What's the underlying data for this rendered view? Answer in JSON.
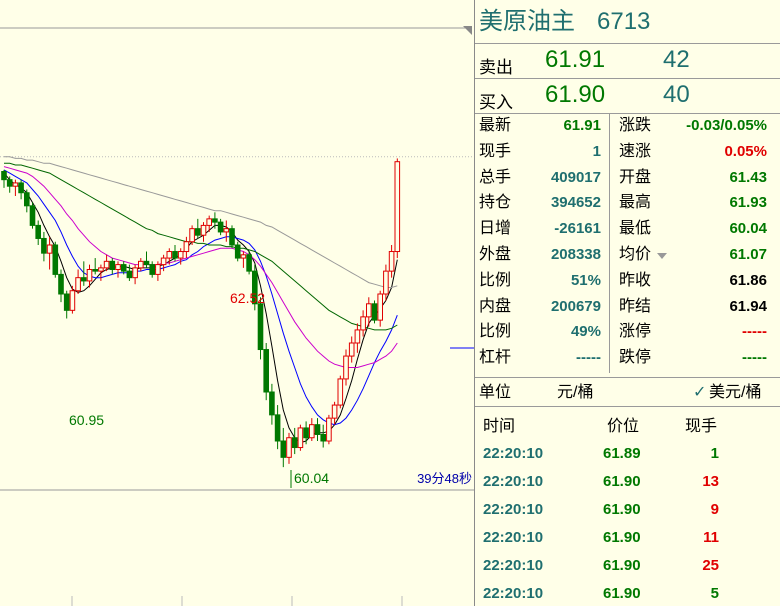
{
  "header": {
    "name": "美原油主",
    "code": "6713"
  },
  "order_book": [
    {
      "label": "卖出",
      "price": "61.91",
      "volume": "42"
    },
    {
      "label": "买入",
      "price": "61.90",
      "volume": "40"
    }
  ],
  "stats_left": [
    {
      "label": "最新",
      "value": "61.91",
      "color": "#007800"
    },
    {
      "label": "现手",
      "value": "1",
      "color": "#1f6f6f"
    },
    {
      "label": "总手",
      "value": "409017",
      "color": "#1f6f6f"
    },
    {
      "label": "持仓",
      "value": "394652",
      "color": "#1f6f6f"
    },
    {
      "label": "日增",
      "value": "-26161",
      "color": "#1f6f6f"
    },
    {
      "label": "外盘",
      "value": "208338",
      "color": "#1f6f6f"
    },
    {
      "label": "比例",
      "value": "51%",
      "color": "#1f6f6f"
    },
    {
      "label": "内盘",
      "value": "200679",
      "color": "#1f6f6f"
    },
    {
      "label": "比例",
      "value": "49%",
      "color": "#1f6f6f"
    },
    {
      "label": "杠杆",
      "value": "-----",
      "color": "#1f6f6f"
    }
  ],
  "stats_right": [
    {
      "label": "涨跌",
      "value": "-0.03/0.05%",
      "color": "#007800"
    },
    {
      "label": "速涨",
      "value": "0.05%",
      "color": "#e00000"
    },
    {
      "label": "开盘",
      "value": "61.43",
      "color": "#007800"
    },
    {
      "label": "最高",
      "value": "61.93",
      "color": "#007800"
    },
    {
      "label": "最低",
      "value": "60.04",
      "color": "#007800"
    },
    {
      "label": "均价",
      "value": "61.07",
      "color": "#007800"
    },
    {
      "label": "昨收",
      "value": "61.86",
      "color": "#000000"
    },
    {
      "label": "昨结",
      "value": "61.94",
      "color": "#000000"
    },
    {
      "label": "涨停",
      "value": "-----",
      "color": "#e00000"
    },
    {
      "label": "跌停",
      "value": "-----",
      "color": "#007800"
    }
  ],
  "unit": {
    "label": "单位",
    "value": "元/桶",
    "check": "✓",
    "alt": "美元/桶"
  },
  "ticks_header": {
    "time": "时间",
    "price": "价位",
    "qty": "现手"
  },
  "ticks": [
    {
      "time": "22:20:10",
      "price": "61.89",
      "qty": "1",
      "qty_color": "#007800"
    },
    {
      "time": "22:20:10",
      "price": "61.90",
      "qty": "13",
      "qty_color": "#e00000"
    },
    {
      "time": "22:20:10",
      "price": "61.90",
      "qty": "9",
      "qty_color": "#e00000"
    },
    {
      "time": "22:20:10",
      "price": "61.90",
      "qty": "11",
      "qty_color": "#e00000"
    },
    {
      "time": "22:20:10",
      "price": "61.90",
      "qty": "25",
      "qty_color": "#e00000"
    },
    {
      "time": "22:20:10",
      "price": "61.90",
      "qty": "5",
      "qty_color": "#007800"
    }
  ],
  "chart_data": {
    "type": "candlestick",
    "annotations": {
      "high_label": "62.52",
      "low_label_1": "60.95",
      "low_label_2": "60.04",
      "countdown": "39分48秒"
    },
    "colors": {
      "up": "#e00000",
      "down": "#007800",
      "ma1": "#000000",
      "ma2": "#0000ff",
      "ma3": "#cc00cc",
      "ma4": "#006600",
      "ma5": "#999999"
    },
    "candles": [
      [
        61.85,
        61.86,
        61.75,
        61.8
      ],
      [
        61.8,
        61.82,
        61.72,
        61.76
      ],
      [
        61.76,
        61.8,
        61.7,
        61.78
      ],
      [
        61.78,
        61.8,
        61.68,
        61.72
      ],
      [
        61.72,
        61.74,
        61.6,
        61.64
      ],
      [
        61.64,
        61.66,
        61.5,
        61.52
      ],
      [
        61.52,
        61.55,
        61.4,
        61.44
      ],
      [
        61.44,
        61.48,
        61.3,
        61.35
      ],
      [
        61.35,
        61.45,
        61.25,
        61.4
      ],
      [
        61.4,
        61.42,
        61.2,
        61.22
      ],
      [
        61.22,
        61.25,
        61.05,
        61.1
      ],
      [
        61.1,
        61.12,
        60.95,
        61.0
      ],
      [
        61.0,
        61.15,
        60.98,
        61.12
      ],
      [
        61.12,
        61.25,
        61.1,
        61.2
      ],
      [
        61.2,
        61.3,
        61.15,
        61.18
      ],
      [
        61.18,
        61.28,
        61.14,
        61.25
      ],
      [
        61.25,
        61.32,
        61.22,
        61.24
      ],
      [
        61.24,
        61.28,
        61.18,
        61.26
      ],
      [
        61.26,
        61.34,
        61.24,
        61.3
      ],
      [
        61.3,
        61.32,
        61.22,
        61.25
      ],
      [
        61.25,
        61.3,
        61.2,
        61.28
      ],
      [
        61.28,
        61.3,
        61.22,
        61.24
      ],
      [
        61.24,
        61.28,
        61.18,
        61.2
      ],
      [
        61.2,
        61.28,
        61.16,
        61.26
      ],
      [
        61.26,
        61.32,
        61.24,
        61.3
      ],
      [
        61.3,
        61.36,
        61.26,
        61.28
      ],
      [
        61.28,
        61.3,
        61.2,
        61.22
      ],
      [
        61.22,
        61.3,
        61.18,
        61.28
      ],
      [
        61.28,
        61.34,
        61.24,
        61.32
      ],
      [
        61.32,
        61.38,
        61.28,
        61.36
      ],
      [
        61.36,
        61.4,
        61.3,
        61.32
      ],
      [
        61.32,
        61.38,
        61.28,
        61.36
      ],
      [
        61.36,
        61.45,
        61.32,
        61.42
      ],
      [
        61.42,
        61.52,
        61.4,
        61.5
      ],
      [
        61.5,
        61.56,
        61.44,
        61.46
      ],
      [
        61.46,
        61.54,
        61.42,
        61.52
      ],
      [
        61.52,
        61.58,
        61.48,
        61.56
      ],
      [
        61.56,
        61.6,
        61.5,
        61.54
      ],
      [
        61.54,
        61.56,
        61.46,
        61.48
      ],
      [
        61.48,
        61.55,
        61.42,
        61.5
      ],
      [
        61.5,
        61.52,
        61.38,
        61.4
      ],
      [
        61.4,
        61.42,
        61.3,
        61.32
      ],
      [
        61.32,
        61.36,
        61.26,
        61.34
      ],
      [
        61.34,
        61.36,
        61.22,
        61.24
      ],
      [
        61.24,
        61.28,
        61.0,
        61.04
      ],
      [
        61.04,
        61.08,
        60.7,
        60.76
      ],
      [
        60.76,
        60.8,
        60.45,
        60.5
      ],
      [
        60.5,
        60.55,
        60.3,
        60.36
      ],
      [
        60.36,
        60.42,
        60.15,
        60.2
      ],
      [
        60.2,
        60.28,
        60.04,
        60.1
      ],
      [
        60.1,
        60.25,
        60.06,
        60.22
      ],
      [
        60.22,
        60.28,
        60.12,
        60.16
      ],
      [
        60.16,
        60.3,
        60.14,
        60.28
      ],
      [
        60.28,
        60.32,
        60.18,
        60.22
      ],
      [
        60.22,
        60.34,
        60.2,
        60.3
      ],
      [
        60.3,
        60.34,
        60.2,
        60.24
      ],
      [
        60.24,
        60.3,
        60.16,
        60.2
      ],
      [
        60.2,
        60.36,
        60.18,
        60.34
      ],
      [
        60.34,
        60.44,
        60.3,
        60.42
      ],
      [
        60.42,
        60.6,
        60.4,
        60.58
      ],
      [
        60.58,
        60.76,
        60.54,
        60.72
      ],
      [
        60.72,
        60.84,
        60.68,
        60.8
      ],
      [
        60.8,
        60.92,
        60.74,
        60.88
      ],
      [
        60.88,
        61.0,
        60.84,
        60.96
      ],
      [
        60.96,
        61.08,
        60.9,
        61.04
      ],
      [
        61.04,
        61.06,
        60.92,
        60.94
      ],
      [
        60.94,
        61.12,
        60.9,
        61.1
      ],
      [
        61.1,
        61.28,
        61.06,
        61.24
      ],
      [
        61.24,
        61.4,
        61.2,
        61.36
      ],
      [
        61.36,
        61.93,
        61.32,
        61.91
      ]
    ],
    "ma_series": [
      {
        "name": "ma5",
        "values": [
          61.84,
          61.8,
          61.77,
          61.75,
          61.72,
          61.66,
          61.6,
          61.52,
          61.45,
          61.39,
          61.3,
          61.2,
          61.13,
          61.11,
          61.12,
          61.15,
          61.19,
          61.23,
          61.25,
          61.26,
          61.27,
          61.27,
          61.26,
          61.25,
          61.26,
          61.26,
          61.26,
          61.27,
          61.28,
          61.3,
          61.32,
          61.34,
          61.38,
          61.42,
          61.44,
          61.46,
          61.49,
          61.52,
          61.52,
          61.51,
          61.48,
          61.43,
          61.4,
          61.36,
          61.29,
          61.15,
          60.98,
          60.78,
          60.57,
          60.39,
          60.28,
          60.22,
          60.19,
          60.2,
          60.24,
          60.25,
          60.25,
          60.26,
          60.3,
          60.36,
          60.46,
          60.57,
          60.7,
          60.82,
          60.92,
          60.97,
          61.01,
          61.06,
          61.14,
          61.31
        ]
      },
      {
        "name": "ma10",
        "values": [
          61.86,
          61.84,
          61.82,
          61.8,
          61.78,
          61.74,
          61.7,
          61.65,
          61.6,
          61.55,
          61.48,
          61.4,
          61.33,
          61.27,
          61.23,
          61.21,
          61.2,
          61.2,
          61.21,
          61.22,
          61.23,
          61.23,
          61.23,
          61.24,
          61.24,
          61.25,
          61.25,
          61.25,
          61.26,
          61.27,
          61.28,
          61.3,
          61.31,
          61.34,
          61.36,
          61.39,
          61.41,
          61.43,
          61.44,
          61.45,
          61.45,
          61.44,
          61.43,
          61.41,
          61.37,
          61.3,
          61.21,
          61.1,
          60.98,
          60.86,
          60.75,
          60.65,
          60.55,
          60.47,
          60.41,
          60.36,
          60.33,
          60.31,
          60.3,
          60.31,
          60.34,
          60.39,
          60.45,
          60.52,
          60.6,
          60.68,
          60.75,
          60.81,
          60.88,
          60.97
        ]
      },
      {
        "name": "ma20",
        "values": [
          61.88,
          61.87,
          61.86,
          61.85,
          61.84,
          61.82,
          61.79,
          61.76,
          61.72,
          61.68,
          61.64,
          61.59,
          61.55,
          61.5,
          61.46,
          61.42,
          61.39,
          61.36,
          61.34,
          61.32,
          61.31,
          61.3,
          61.29,
          61.28,
          61.28,
          61.28,
          61.28,
          61.28,
          61.29,
          61.29,
          61.3,
          61.31,
          61.32,
          61.33,
          61.34,
          61.35,
          61.36,
          61.37,
          61.38,
          61.38,
          61.38,
          61.37,
          61.36,
          61.34,
          61.31,
          61.27,
          61.22,
          61.17,
          61.11,
          61.05,
          60.99,
          60.93,
          60.88,
          60.83,
          60.79,
          60.75,
          60.72,
          60.69,
          60.67,
          60.66,
          60.65,
          60.65,
          60.65,
          60.66,
          60.67,
          60.68,
          60.7,
          60.72,
          60.75,
          60.8
        ]
      },
      {
        "name": "ma40",
        "values": [
          61.9,
          61.9,
          61.89,
          61.89,
          61.88,
          61.87,
          61.86,
          61.85,
          61.84,
          61.82,
          61.8,
          61.78,
          61.76,
          61.74,
          61.72,
          61.7,
          61.68,
          61.66,
          61.64,
          61.62,
          61.6,
          61.58,
          61.56,
          61.54,
          61.52,
          61.5,
          61.49,
          61.47,
          61.46,
          61.45,
          61.44,
          61.43,
          61.42,
          61.42,
          61.41,
          61.41,
          61.4,
          61.4,
          61.4,
          61.39,
          61.39,
          61.38,
          61.38,
          61.37,
          61.36,
          61.34,
          61.32,
          61.3,
          61.27,
          61.24,
          61.21,
          61.18,
          61.15,
          61.12,
          61.09,
          61.06,
          61.03,
          61.0,
          60.98,
          60.96,
          60.94,
          60.92,
          60.91,
          60.9,
          60.89,
          60.88,
          60.88,
          60.88,
          60.89,
          60.91
        ]
      },
      {
        "name": "ma80",
        "values": [
          61.94,
          61.94,
          61.93,
          61.93,
          61.92,
          61.92,
          61.91,
          61.9,
          61.9,
          61.89,
          61.88,
          61.87,
          61.86,
          61.85,
          61.84,
          61.83,
          61.82,
          61.81,
          61.8,
          61.79,
          61.78,
          61.77,
          61.76,
          61.75,
          61.74,
          61.73,
          61.72,
          61.71,
          61.7,
          61.69,
          61.68,
          61.67,
          61.66,
          61.65,
          61.64,
          61.63,
          61.62,
          61.61,
          61.61,
          61.6,
          61.59,
          61.58,
          61.57,
          61.56,
          61.55,
          61.54,
          61.52,
          61.51,
          61.49,
          61.47,
          61.45,
          61.43,
          61.41,
          61.39,
          61.37,
          61.35,
          61.33,
          61.31,
          61.29,
          61.27,
          61.25,
          61.23,
          61.21,
          61.19,
          61.17,
          61.16,
          61.15,
          61.14,
          61.14,
          61.15
        ]
      }
    ],
    "reference_price": 61.94,
    "y_range": [
      59.9,
      62.9
    ]
  }
}
